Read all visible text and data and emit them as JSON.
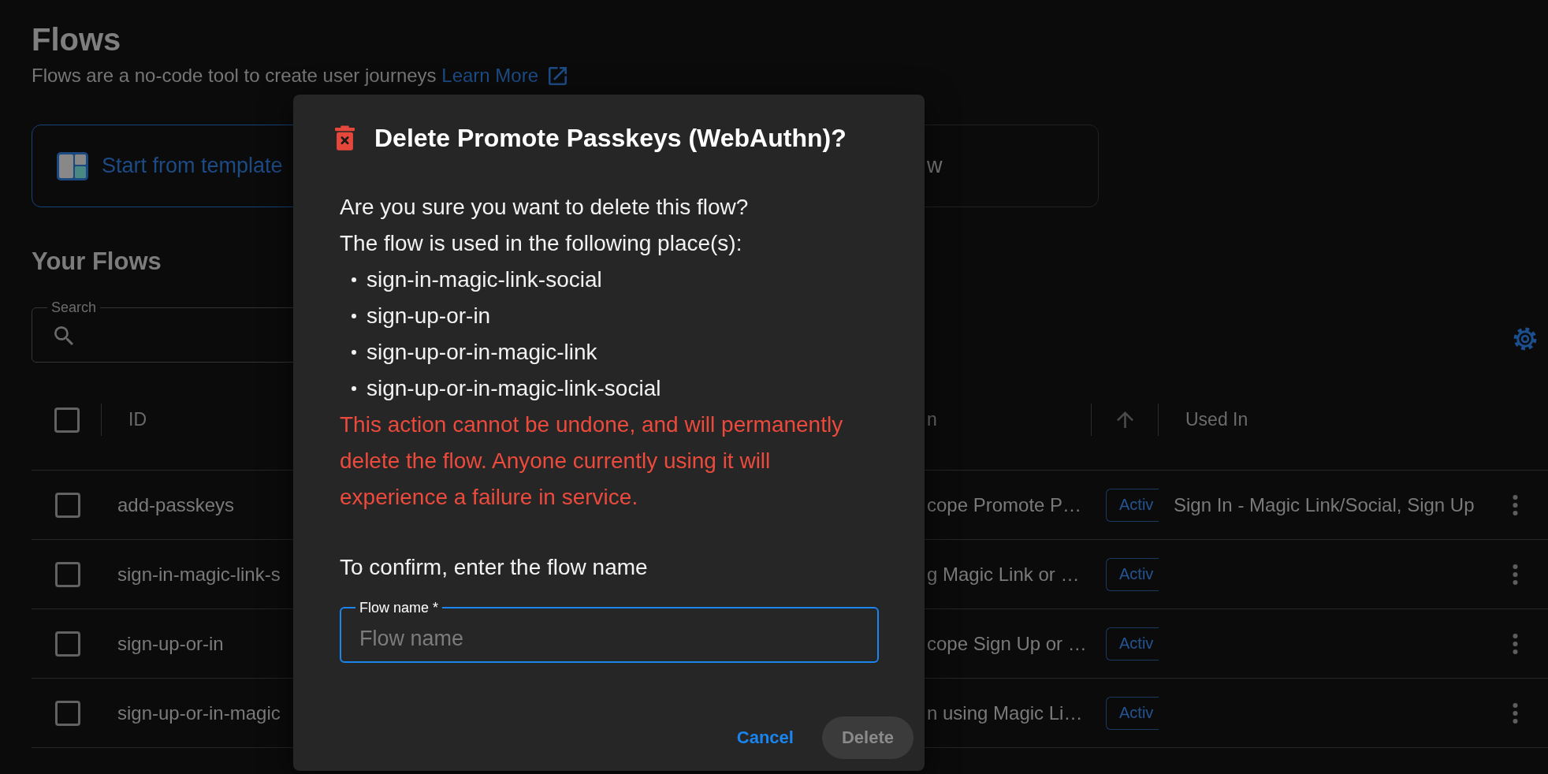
{
  "header": {
    "title": "Flows",
    "subtitle": "Flows are a no-code tool to create user journeys",
    "link": "Learn More"
  },
  "start_options": [
    {
      "kind": "template",
      "label": "Start from template"
    },
    {
      "kind": "plain",
      "label": "w"
    }
  ],
  "your_flows": {
    "heading": "Your Flows",
    "search": {
      "label": "Search"
    }
  },
  "table": {
    "select_all_checked": false,
    "columns": [
      {
        "kind": "text",
        "label": "ID"
      },
      {
        "kind": "text",
        "label": "n"
      },
      {
        "kind": "sort"
      },
      {
        "kind": "text",
        "label": "Used In"
      }
    ],
    "rows": [
      {
        "id": "add-passkeys",
        "description": "cope Promote P…",
        "status": "Activ",
        "used_in": "Sign In - Magic Link/Social, Sign Up",
        "checked": false
      },
      {
        "id": "sign-in-magic-link-s",
        "description": "g Magic Link or …",
        "status": "Activ",
        "checked": false
      },
      {
        "id": "sign-up-or-in",
        "description": "cope Sign Up or …",
        "status": "Activ",
        "checked": false
      },
      {
        "id": "sign-up-or-in-magic",
        "description": "n using Magic Li…",
        "status": "Activ",
        "checked": false
      }
    ]
  },
  "dialog": {
    "title": "Delete Promote Passkeys (WebAuthn)?",
    "question": "Are you sure you want to delete this flow?",
    "usage_intro": "The flow is used in the following place(s):",
    "usages": [
      "sign-in-magic-link-social",
      "sign-up-or-in",
      "sign-up-or-in-magic-link",
      "sign-up-or-in-magic-link-social"
    ],
    "warning": "This action cannot be undone, and will permanently delete the flow. Anyone currently using it will experience a failure in service.",
    "confirm_prompt": "To confirm, enter the flow name",
    "name_field": {
      "label": "Flow name *",
      "placeholder": "Flow name",
      "focused": true
    },
    "buttons": [
      {
        "kind": "text",
        "label": "Cancel",
        "disabled": false
      },
      {
        "kind": "contained",
        "label": "Delete",
        "disabled": true
      }
    ]
  }
}
